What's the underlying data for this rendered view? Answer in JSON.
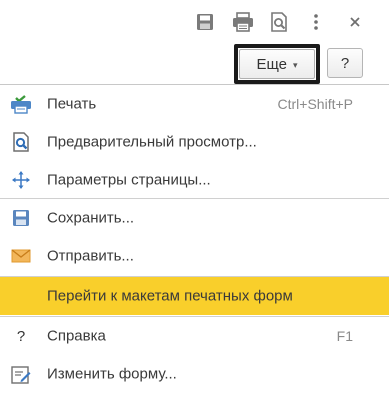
{
  "toolbar": {
    "icons": [
      "save-icon",
      "print-icon",
      "preview-icon",
      "more-vertical-icon",
      "close-icon"
    ],
    "more_label": "Еще",
    "more_caret": "▾",
    "help_label": "?"
  },
  "menu": {
    "items": [
      {
        "icon": "print-green-icon",
        "label": "Печать",
        "shortcut": "Ctrl+Shift+P"
      },
      {
        "icon": "preview-icon",
        "label": "Предварительный просмотр...",
        "shortcut": ""
      },
      {
        "icon": "page-settings-icon",
        "label": "Параметры страницы...",
        "shortcut": ""
      },
      {
        "icon": "save-icon",
        "label": "Сохранить...",
        "shortcut": ""
      },
      {
        "icon": "mail-icon",
        "label": "Отправить...",
        "shortcut": ""
      },
      {
        "icon": "",
        "label": "Перейти к макетам печатных форм",
        "shortcut": "",
        "highlighted": true
      },
      {
        "icon": "help-icon",
        "label": "Справка",
        "shortcut": "F1",
        "glyph": "?"
      },
      {
        "icon": "edit-form-icon",
        "label": "Изменить форму...",
        "shortcut": ""
      }
    ]
  },
  "colors": {
    "highlight": "#f9cf2b",
    "icon_gray": "#7a7a7a",
    "print_green": "#3c9a3c",
    "preview_blue": "#2f6db5",
    "mail_orange": "#e8a13a"
  }
}
